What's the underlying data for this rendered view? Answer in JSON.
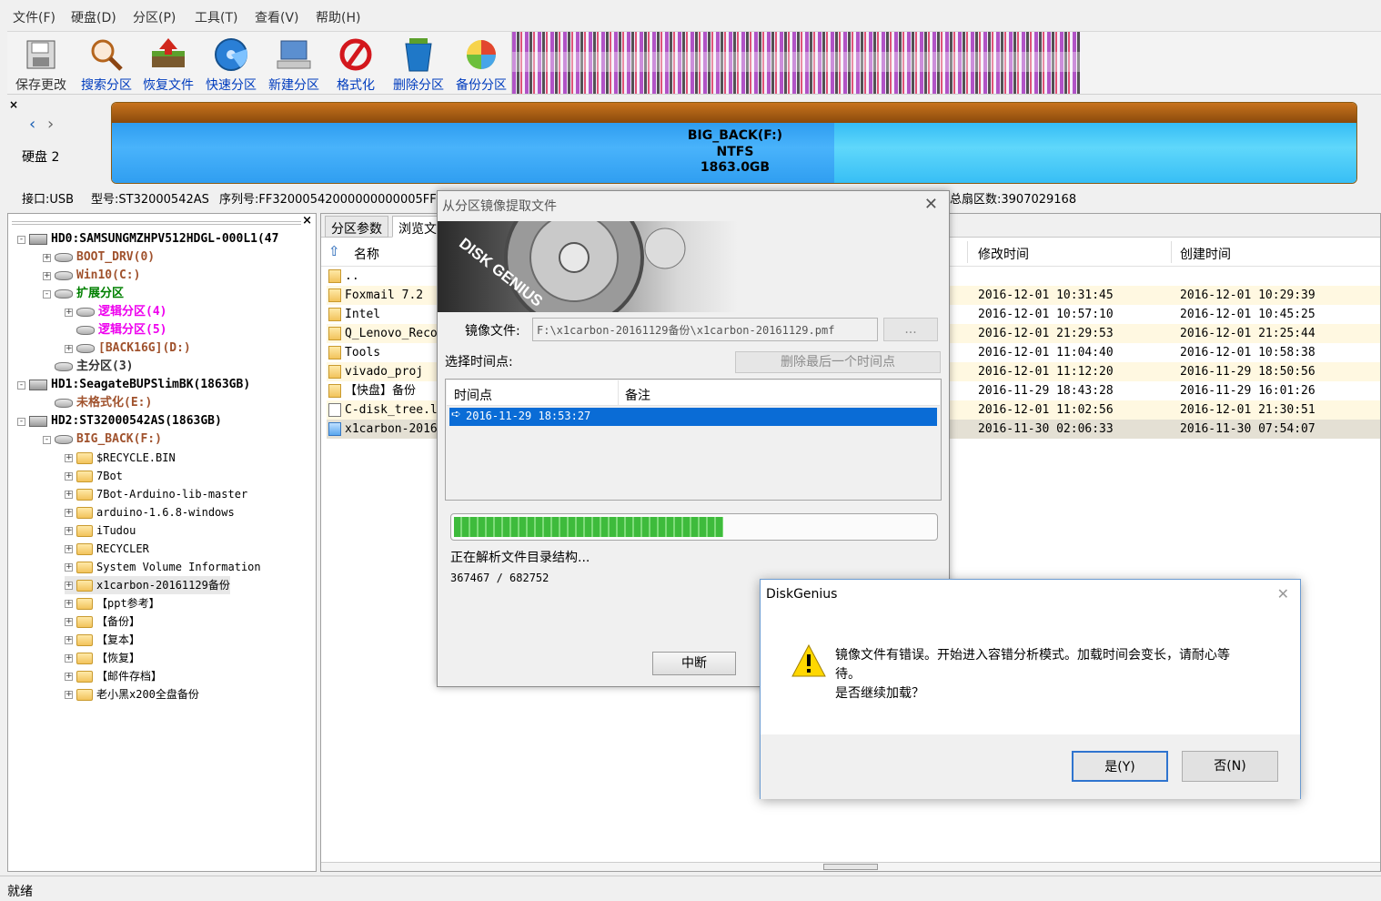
{
  "menu": [
    "文件(F)",
    "硬盘(D)",
    "分区(P)",
    "工具(T)",
    "查看(V)",
    "帮助(H)"
  ],
  "toolbar": [
    "保存更改",
    "搜索分区",
    "恢复文件",
    "快速分区",
    "新建分区",
    "格式化",
    "删除分区",
    "备份分区"
  ],
  "disk_panel": {
    "disk_label": "硬盘 2",
    "partition_name": "BIG_BACK(F:)",
    "partition_fs": "NTFS",
    "partition_size": "1863.0GB"
  },
  "disk_info": {
    "interface": "接口:USB",
    "model": "型号:ST32000542AS",
    "serial": "序列号:FF32000542000000000005FF",
    "total_sectors": "总扇区数:3907029168"
  },
  "tree": [
    {
      "label": "HD0:SAMSUNGMZHPV512HDGL-000L1(47",
      "color": "#000000"
    },
    {
      "label": "BOOT_DRV(0)",
      "color": "#a0522d"
    },
    {
      "label": "Win10(C:)",
      "color": "#a0522d"
    },
    {
      "label": "扩展分区",
      "color": "#008000"
    },
    {
      "label": "逻辑分区(4)",
      "color": "#ee00ee"
    },
    {
      "label": "逻辑分区(5)",
      "color": "#ee00ee"
    },
    {
      "label": "[BACK16G](D:)",
      "color": "#a0522d"
    },
    {
      "label": "主分区(3)",
      "color": "#333333"
    },
    {
      "label": "HD1:SeagateBUPSlimBK(1863GB)",
      "color": "#000000"
    },
    {
      "label": "未格式化(E:)",
      "color": "#a0522d"
    },
    {
      "label": "HD2:ST32000542AS(1863GB)",
      "color": "#000000"
    },
    {
      "label": "BIG_BACK(F:)",
      "color": "#a0522d"
    },
    {
      "label": "$RECYCLE.BIN",
      "color": "#000000"
    },
    {
      "label": "7Bot",
      "color": "#000000"
    },
    {
      "label": "7Bot-Arduino-lib-master",
      "color": "#000000"
    },
    {
      "label": "arduino-1.6.8-windows",
      "color": "#000000"
    },
    {
      "label": "iTudou",
      "color": "#000000"
    },
    {
      "label": "RECYCLER",
      "color": "#000000"
    },
    {
      "label": "System Volume Information",
      "color": "#000000"
    },
    {
      "label": "x1carbon-20161129备份",
      "color": "#000000"
    },
    {
      "label": "【ppt参考】",
      "color": "#000000"
    },
    {
      "label": "【备份】",
      "color": "#000000"
    },
    {
      "label": "【复本】",
      "color": "#000000"
    },
    {
      "label": "【恢复】",
      "color": "#000000"
    },
    {
      "label": "【邮件存档】",
      "color": "#000000"
    },
    {
      "label": "老小黑x200全盘备份",
      "color": "#000000"
    }
  ],
  "tabs": [
    "分区参数",
    "浏览文"
  ],
  "file_table": {
    "columns": {
      "name": "名称",
      "modified": "修改时间",
      "created": "创建时间"
    },
    "rows": [
      {
        "name": "..",
        "modified": "",
        "created": ""
      },
      {
        "name": "Foxmail 7.2",
        "modified": "2016-12-01 10:31:45",
        "created": "2016-12-01 10:29:39"
      },
      {
        "name": "Intel",
        "modified": "2016-12-01 10:57:10",
        "created": "2016-12-01 10:45:25"
      },
      {
        "name": "Q_Lenovo_Reco",
        "modified": "2016-12-01 21:29:53",
        "created": "2016-12-01 21:25:44"
      },
      {
        "name": "Tools",
        "modified": "2016-12-01 11:04:40",
        "created": "2016-12-01 10:58:38"
      },
      {
        "name": "vivado_proj",
        "modified": "2016-12-01 11:12:20",
        "created": "2016-11-29 18:50:56"
      },
      {
        "name": "【快盘】备份",
        "modified": "2016-11-29 18:43:28",
        "created": "2016-11-29 16:01:26"
      },
      {
        "name": "C-disk_tree.l",
        "modified": "2016-12-01 11:02:56",
        "created": "2016-12-01 21:30:51"
      },
      {
        "name": "x1carbon-2016",
        "modified": "2016-11-30 02:06:33",
        "created": "2016-11-30 07:54:07"
      }
    ]
  },
  "status": "就绪",
  "extract_dialog": {
    "title": "从分区镜像提取文件",
    "banner_text": "DISK GENIUS",
    "image_label": "镜像文件:",
    "image_path": "F:\\x1carbon-20161129备份\\x1carbon-20161129.pmf",
    "browse_label": "...",
    "time_label": "选择时间点:",
    "delete_last_label": "删除最后一个时间点",
    "col_time": "时间点",
    "col_note": "备注",
    "time_point": "2016-11-29 18:53:27",
    "progress": 0.56,
    "status_text": "正在解析文件目录结构...",
    "count_text": "367467 / 682752",
    "abort_label": "中断"
  },
  "confirm_dialog": {
    "title": "DiskGenius",
    "message_line1": "镜像文件有错误。开始进入容错分析模式。加载时间会变长，请耐心等",
    "message_line2": "待。",
    "message_line3": "是否继续加载？",
    "yes_label": "是(Y)",
    "no_label": "否(N)"
  }
}
